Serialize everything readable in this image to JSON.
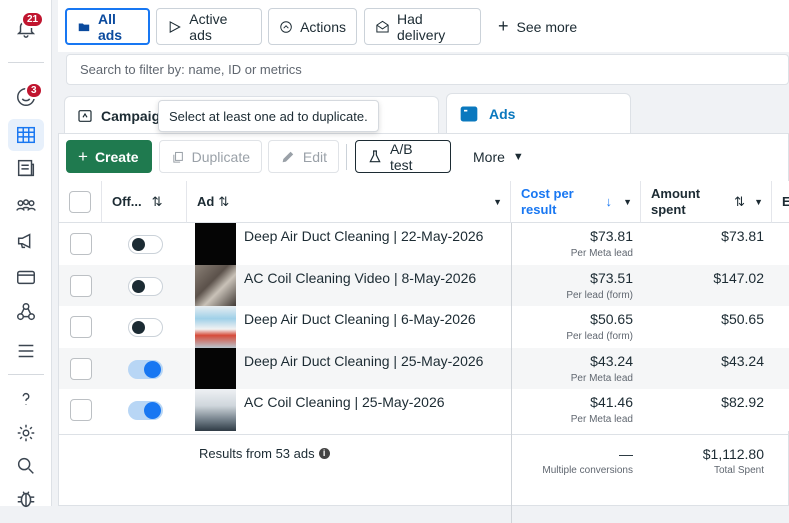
{
  "rail": {
    "notif_count": "21",
    "msg_count": "3"
  },
  "filters": {
    "all_ads": "All ads",
    "active_ads": "Active ads",
    "actions": "Actions",
    "had_delivery": "Had delivery",
    "see_more": "See more"
  },
  "search": {
    "placeholder": "Search to filter by: name, ID or metrics"
  },
  "tabs": {
    "campaigns": "Campaig",
    "ads": "Ads"
  },
  "tooltip": "Select at least one ad to duplicate.",
  "toolbar": {
    "create": "Create",
    "duplicate": "Duplicate",
    "edit": "Edit",
    "ab_test": "A/B test",
    "more": "More"
  },
  "columns": {
    "off": "Off...",
    "ad": "Ad",
    "cost": "Cost per result",
    "amount": "Amount spent",
    "extra": "E"
  },
  "rows": [
    {
      "name": "Deep Air Duct Cleaning | 22-May-2026",
      "on": false,
      "cost": "$73.81",
      "cost_sub": "Per Meta lead",
      "spent": "$73.81"
    },
    {
      "name": "AC Coil Cleaning Video | 8-May-2026",
      "on": false,
      "cost": "$73.51",
      "cost_sub": "Per lead (form)",
      "spent": "$147.02"
    },
    {
      "name": "Deep Air Duct Cleaning | 6-May-2026",
      "on": false,
      "cost": "$50.65",
      "cost_sub": "Per lead (form)",
      "spent": "$50.65"
    },
    {
      "name": "Deep Air Duct Cleaning | 25-May-2026",
      "on": true,
      "cost": "$43.24",
      "cost_sub": "Per Meta lead",
      "spent": "$43.24"
    },
    {
      "name": "AC Coil Cleaning | 25-May-2026",
      "on": true,
      "cost": "$41.46",
      "cost_sub": "Per Meta lead",
      "spent": "$82.92"
    }
  ],
  "footer": {
    "results": "Results from 53 ads",
    "cost": "—",
    "cost_sub": "Multiple conversions",
    "spent": "$1,112.80",
    "spent_sub": "Total Spent"
  }
}
